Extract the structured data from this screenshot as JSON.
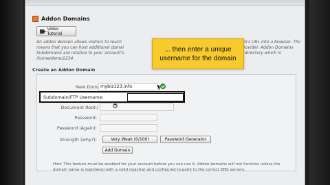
{
  "page": {
    "title": "Addon Domains",
    "video_button": "Video Tutorial",
    "intro_lines": [
      "An addon domain allows visitors to reach",
      "means that you can host additional domai",
      "Subdomains are relative to your account's",
      "/home/demo1234."
    ],
    "intro_right_lines": [
      "domain's URL into a browser. This",
      "ting provider. Addon Domains",
      "home directory which is"
    ],
    "section_title": "Create an Addon Domain"
  },
  "form": {
    "new_domain": {
      "label": "New Domain Name:",
      "value": "mybiz123.info",
      "status": "valid"
    },
    "subdomain": {
      "label": "Subdomain/FTP Username:",
      "value": ""
    },
    "document_root": {
      "label": "Document Root:",
      "prefix": "/",
      "value": ""
    },
    "password": {
      "label": "Password:",
      "value": ""
    },
    "password_again": {
      "label": "Password (Again):",
      "value": ""
    },
    "strength": {
      "label": "Strength (why?):",
      "value": "Very Weak (0/100)"
    },
    "password_generator": "Password Generator",
    "submit": "Add Domain"
  },
  "note_lines": [
    "Hint: This feature must be enabled for your account before you can use it. Addon domains will not function unless the",
    "domain name is registered with a valid registrar and configured to point to the correct DNS servers."
  ],
  "tooltip": {
    "line1": "... then enter a unique",
    "line2": "username for the domain"
  },
  "colors": {
    "tooltip_bg": "#f7ca2e",
    "panel_bg": "#ecedef",
    "check": "#3da33d",
    "title_icon": "#e8782a"
  },
  "icons": [
    "addon-domain-icon",
    "video-icon",
    "check-icon",
    "cursor-icon",
    "wait-icon"
  ]
}
